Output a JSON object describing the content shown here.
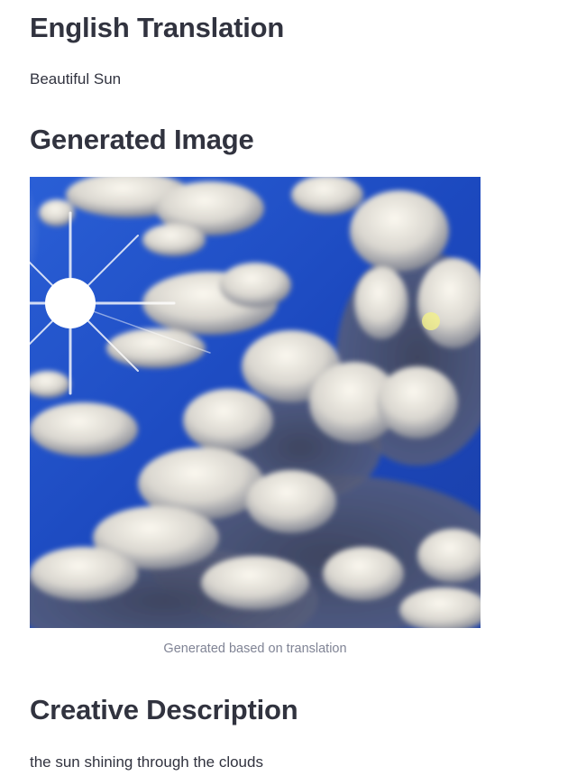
{
  "sections": {
    "translation": {
      "heading": "English Translation",
      "text": "Beautiful Sun"
    },
    "image": {
      "heading": "Generated Image",
      "caption": "Generated based on translation",
      "alt": "Generated image: sun shining through clouds in a blue sky"
    },
    "description": {
      "heading": "Creative Description",
      "text": "the sun shining through the clouds"
    }
  },
  "colors": {
    "text": "#31333f",
    "caption": "#808495",
    "sky": "#1f4fc4",
    "background": "#ffffff"
  }
}
